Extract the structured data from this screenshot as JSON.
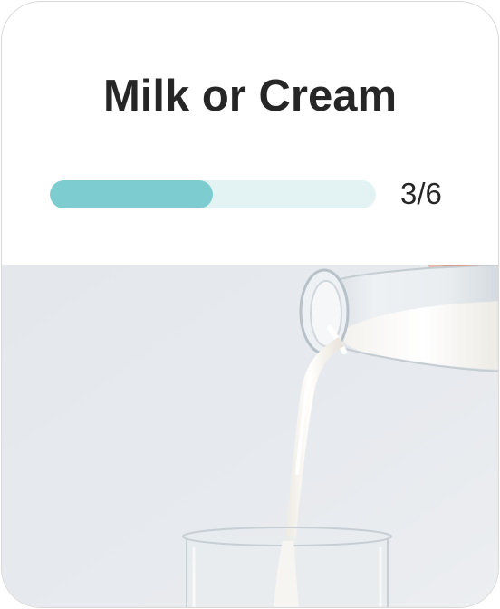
{
  "question": {
    "title": "Milk or Cream"
  },
  "progress": {
    "current": 3,
    "total": 6,
    "label": "3/6",
    "fill_fraction": 0.5
  },
  "image": {
    "subject": "milk-pouring-photo"
  },
  "colors": {
    "progress_fill": "#7dcdd0",
    "progress_track": "#e3f2f3",
    "title_text": "#262626"
  }
}
